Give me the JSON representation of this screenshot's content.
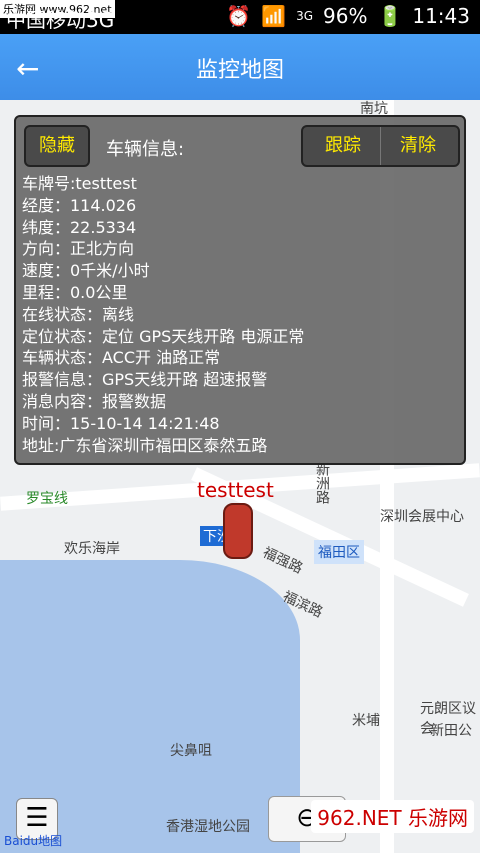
{
  "status": {
    "carrier": "中国移动3G",
    "net": "3G",
    "battery": "96%",
    "time": "11:43",
    "watermark": "乐游网 www.962.net"
  },
  "appbar": {
    "title": "监控地图"
  },
  "panel": {
    "hide": "隐藏",
    "label": "车辆信息:",
    "track": "跟踪",
    "clear": "清除",
    "lines": [
      "车牌号:testtest",
      "经度：114.026",
      "纬度：22.5334",
      "方向：正北方向",
      "速度：0千米/小时",
      "里程：0.0公里",
      "在线状态：离线",
      "定位状态：定位 GPS天线开路 电源正常",
      "车辆状态：ACC开 油路正常",
      "报警信息：GPS天线开路 超速报警",
      "消息内容：报警数据",
      "时间：15-10-14 14:21:48",
      "地址:广东省深圳市福田区泰然五路"
    ]
  },
  "map": {
    "car_label": "testtest",
    "labels": {
      "nanyuan": "南坑",
      "luobao": "罗宝线",
      "huanle": "欢乐海岸",
      "xinzhou": "新洲路",
      "huizhan": "深圳会展中心",
      "futian": "福田区",
      "fuqiang": "福强路",
      "fubin": "福滨路",
      "xiasha": "下沙",
      "jianbi": "尖鼻咀",
      "mipu": "米埔",
      "yuanlang": "元朗区议会",
      "xintian": "新田公",
      "xianggang": "香港湿地公园"
    },
    "baidu": "Baidu地图"
  },
  "watermark_br": "962.NET 乐游网"
}
